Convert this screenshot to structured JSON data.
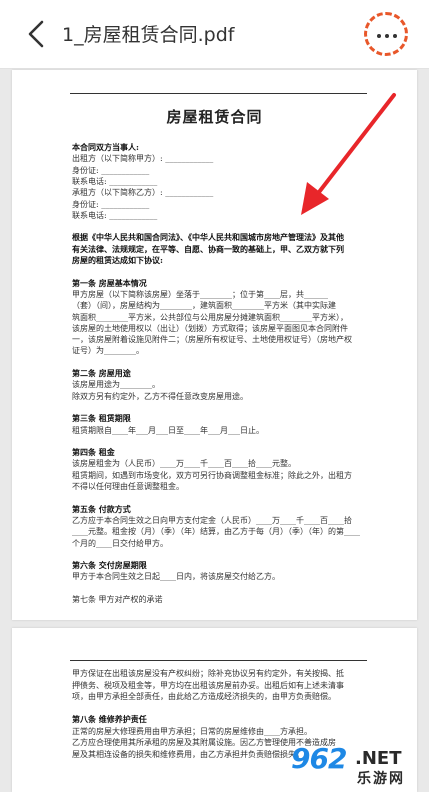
{
  "header": {
    "title": "1_房屋租赁合同.pdf"
  },
  "doc": {
    "title": "房屋租赁合同",
    "page1_lines": [
      {
        "text": "本合同双方当事人:",
        "bold": true
      },
      {
        "text": "出租方（以下简称甲方）: ____________",
        "bold": false
      },
      {
        "text": "身份证: ____________",
        "bold": false
      },
      {
        "text": "联系电话: ____________",
        "bold": false
      },
      {
        "text": "承租方（以下简称乙方）: ____________",
        "bold": false
      },
      {
        "text": "身份证: ____________",
        "bold": false
      },
      {
        "text": "联系电话: ____________",
        "bold": false
      },
      {
        "text": "",
        "bold": false
      },
      {
        "text": "根据《中华人民共和国合同法》、《中华人民共和国城市房地产管理法》及其他",
        "bold": true
      },
      {
        "text": "有关法律、法规规定，在平等、自愿、协商一致的基础上，甲、乙双方就下列",
        "bold": true
      },
      {
        "text": "房屋的租赁达成如下协议:",
        "bold": true
      },
      {
        "text": "",
        "bold": false
      },
      {
        "text": "第一条 房屋基本情况",
        "bold": true
      },
      {
        "text": "甲方房屋（以下简称该房屋）坐落于________；位于第____层，共______",
        "bold": false
      },
      {
        "text": "（套）（间），房屋结构为________，建筑面积________平方米（其中实际建",
        "bold": false
      },
      {
        "text": "筑面积________平方米，公共部位与公用房屋分摊建筑面积________平方米），",
        "bold": false
      },
      {
        "text": "该房屋的土地使用权以（出让）（划拨）方式取得；该房屋平面图见本合同附件",
        "bold": false
      },
      {
        "text": "一，该房屋附着设施见附件二；（房屋所有权证号、土地使用权证号）（房地产权",
        "bold": false
      },
      {
        "text": "证号）为________。",
        "bold": false
      },
      {
        "text": "",
        "bold": false
      },
      {
        "text": "第二条 房屋用途",
        "bold": true
      },
      {
        "text": "该房屋用途为________。",
        "bold": false
      },
      {
        "text": "除双方另有约定外，乙方不得任意改变房屋用途。",
        "bold": false
      },
      {
        "text": "",
        "bold": false
      },
      {
        "text": "第三条 租赁期限",
        "bold": true
      },
      {
        "text": "租赁期限自____年___月___日至____年___月___日止。",
        "bold": false
      },
      {
        "text": "",
        "bold": false
      },
      {
        "text": "第四条 租金",
        "bold": true
      },
      {
        "text": "该房屋租金为（人民币）____万____千____百____拾____元整。",
        "bold": false
      },
      {
        "text": "租赁期间，如遇到市场变化，双方可另行协商调整租金标准；除此之外，出租方",
        "bold": false
      },
      {
        "text": "不得以任何理由任意调整租金。",
        "bold": false
      },
      {
        "text": "",
        "bold": false
      },
      {
        "text": "第五条 付款方式",
        "bold": true
      },
      {
        "text": "乙方应于本合同生效之日向甲方支付定金（人民币）____万____千____百____拾",
        "bold": false
      },
      {
        "text": "____元整。租金按（月）（季）（年）结算，由乙方于每（月）（季）（年）的第____",
        "bold": false
      },
      {
        "text": "个月的____日交付给甲方。",
        "bold": false
      },
      {
        "text": "",
        "bold": false
      },
      {
        "text": "第六条 交付房屋期限",
        "bold": true
      },
      {
        "text": "甲方于本合同生效之日起____日内，将该房屋交付给乙方。",
        "bold": false
      },
      {
        "text": "",
        "bold": false
      },
      {
        "text": "第七条 甲方对产权的承诺",
        "bold": false
      }
    ],
    "page2_lines": [
      {
        "text": "甲方保证在出租该房屋没有产权纠纷；除补充协议另有约定外，有关按揭、抵",
        "bold": false
      },
      {
        "text": "押债务、税项及租金等，甲方均在出租该房屋前办妥。出租后如有上述未清事",
        "bold": false
      },
      {
        "text": "项，由甲方承担全部责任，由此给乙方造成经济损失的，由甲方负责赔偿。",
        "bold": false
      },
      {
        "text": "",
        "bold": false
      },
      {
        "text": "第八条 维修养护责任",
        "bold": true
      },
      {
        "text": "正常的房屋大修理费用由甲方承担；日常的房屋维修由____方承担。",
        "bold": false
      },
      {
        "text": "乙方应合理使用其所承租的房屋及其附属设施。因乙方管理使用不善造成房",
        "bold": false
      },
      {
        "text": "屋及其相连设备的损失和维修费用，由乙方承担并负责赔偿损失。",
        "bold": false
      }
    ]
  },
  "watermark": {
    "logo": "962",
    "suffix": ".NET",
    "cn": "乐游网"
  }
}
